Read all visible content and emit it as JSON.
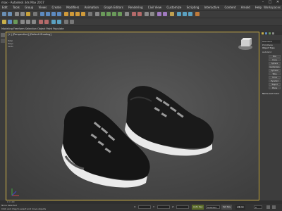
{
  "window": {
    "title": "max - Autodesk 3ds Max 2017",
    "minimize": "–",
    "maximize": "□",
    "close": "✕"
  },
  "menubar": {
    "items": [
      "Edit",
      "Tools",
      "Group",
      "Views",
      "Create",
      "Modifiers",
      "Animation",
      "Graph Editors",
      "Rendering",
      "Civil View",
      "Customize",
      "Scripting",
      "Interactive",
      "Content",
      "Arnold",
      "Help"
    ],
    "workspace": "Workspaces"
  },
  "ribbon": {
    "text": "Modeling  Freeform  Selection  Object Paint  Populate"
  },
  "viewport": {
    "label": "[+] [Perspective] [Default Shading]",
    "stats": [
      "Total",
      "Polys",
      "Verts"
    ]
  },
  "command_panel": {
    "section": "Standard Primitives",
    "rollout_object_type": "Object Type",
    "autogrid": "AutoGrid",
    "buttons": [
      "Box",
      "Cone",
      "Sphere",
      "GeoSphere",
      "Cylinder",
      "Tube",
      "Torus",
      "Pyramid",
      "Teapot",
      "Plane"
    ],
    "rollout_name_color": "Name and Color"
  },
  "timeline": {
    "label": "0 / 100"
  },
  "statusbar": {
    "selection": "None Selected",
    "prompt": "Click and drag to select and move objects",
    "x_label": "X:",
    "y_label": "Y:",
    "z_label": "Z:",
    "autokey": "Auto Key",
    "selected": "Selected",
    "setkey": "Set Key",
    "frame": "0"
  },
  "colors": {
    "viewport_border": "#d8b84a",
    "autokey_bg": "#5a6a2a",
    "shoe_sole": "#e8e8e8",
    "shoe_upper": "#141414"
  }
}
